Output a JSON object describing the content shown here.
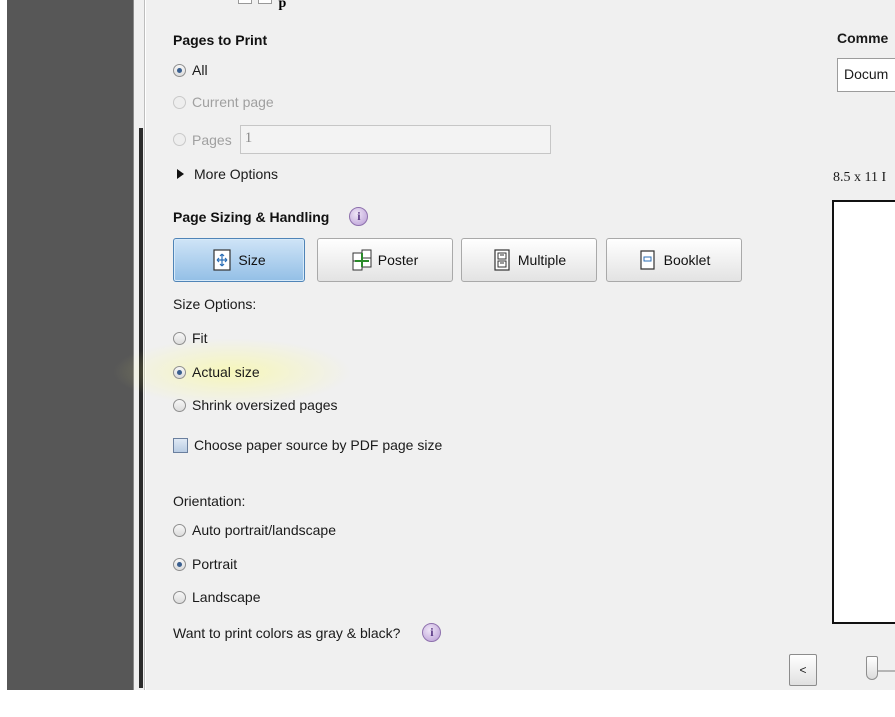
{
  "top_fragment": {
    "text": "p"
  },
  "pages_to_print": {
    "title": "Pages to Print",
    "options": {
      "all": "All",
      "current": "Current page",
      "pages": "Pages"
    },
    "pages_value": "1",
    "more_options": "More Options"
  },
  "page_sizing": {
    "title": "Page Sizing & Handling",
    "info": "i",
    "buttons": {
      "size": "Size",
      "poster": "Poster",
      "multiple": "Multiple",
      "booklet": "Booklet"
    },
    "size_options_label": "Size Options:",
    "size_options": {
      "fit": "Fit",
      "actual": "Actual size",
      "shrink": "Shrink oversized pages"
    },
    "paper_source": "Choose paper source by PDF page size"
  },
  "orientation": {
    "label": "Orientation:",
    "options": {
      "auto": "Auto portrait/landscape",
      "portrait": "Portrait",
      "landscape": "Landscape"
    }
  },
  "gray_prompt": {
    "text": "Want to print colors as gray & black?",
    "info": "i"
  },
  "right": {
    "comments_title": "Comme",
    "comments_value": "Docum",
    "paper_size": "8.5 x 11 I",
    "prev_button": "<"
  },
  "colors": {
    "active_button": "#93bfe6",
    "left_panel": "#575757",
    "dialog_bg": "#f0f0f0",
    "info": "#b79ad4"
  }
}
